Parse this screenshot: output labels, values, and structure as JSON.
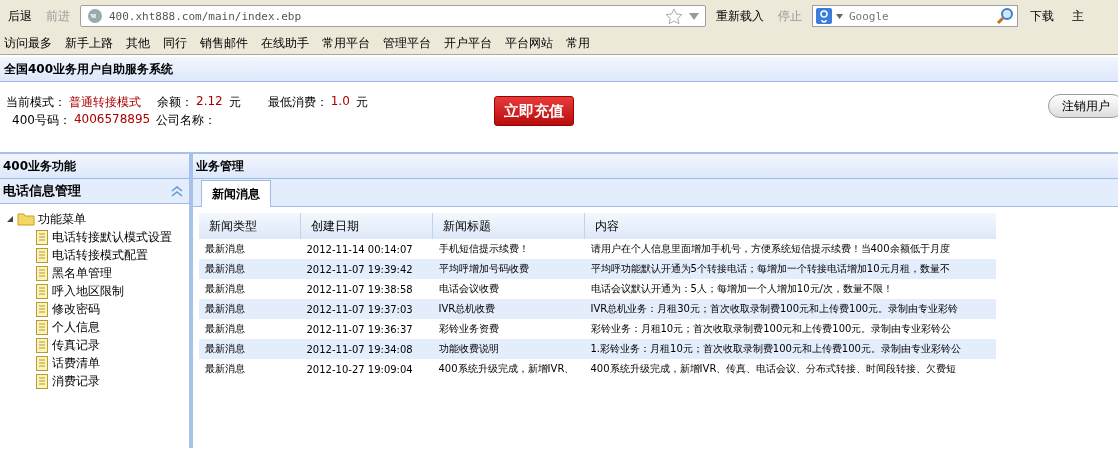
{
  "browser": {
    "nav": [
      {
        "label": "后退",
        "disabled": false
      },
      {
        "label": "前进",
        "disabled": true
      }
    ],
    "url": "400.xht888.com/main/index.ebp",
    "actions": [
      {
        "label": "重新载入",
        "disabled": false
      },
      {
        "label": "停止",
        "disabled": true
      }
    ],
    "search": {
      "placeholder": "Google"
    },
    "right": [
      "下载",
      "主"
    ],
    "bookmarks": [
      "访问最多",
      "新手上路",
      "其他",
      "同行",
      "销售邮件",
      "在线助手",
      "常用平台",
      "管理平台",
      "开户平台",
      "平台网站",
      "常用"
    ]
  },
  "header": {
    "title": "全国400业务用户自助服务系统"
  },
  "info": {
    "mode_label": "当前模式：",
    "mode": "普通转接模式",
    "balance_label": "余额：",
    "balance": "2.12",
    "unit1": "元",
    "min_label": "最低消费：",
    "min": "1.0",
    "unit2": "元",
    "number_label": "400号码：",
    "number": "4006578895",
    "company_label": "公司名称：",
    "recharge": "立即充值",
    "logout": "注销用户"
  },
  "sidebar": {
    "title": "400业务功能",
    "section": {
      "label": "电话信息管理",
      "expanded": true
    },
    "tree": [
      {
        "label": "功能菜单",
        "expanded": true,
        "children": [
          {
            "label": "电话转接默认模式设置"
          },
          {
            "label": "电话转接模式配置"
          },
          {
            "label": "黑名单管理"
          },
          {
            "label": "呼入地区限制"
          },
          {
            "label": "修改密码"
          },
          {
            "label": "个人信息"
          },
          {
            "label": "传真记录"
          },
          {
            "label": "话费清单"
          },
          {
            "label": "消费记录"
          }
        ]
      }
    ]
  },
  "main": {
    "title": "业务管理",
    "tabs": [
      {
        "label": "新闻消息",
        "selected": true
      }
    ],
    "table": {
      "columns": [
        "新闻类型",
        "创建日期",
        "新闻标题",
        "内容"
      ],
      "rows": [
        [
          "最新消息",
          "2012-11-14 00:14:07",
          "手机短信提示续费！",
          "请用户在个人信息里面增加手机号，方便系统短信提示续费！当400余额低于月度"
        ],
        [
          "最新消息",
          "2012-11-07 19:39:42",
          "平均呼增加号码收费",
          "平均呼功能默认开通为5个转接电话；每增加一个转接电话增加10元月租，数量不"
        ],
        [
          "最新消息",
          "2012-11-07 19:38:58",
          "电话会议收费",
          "电话会议默认开通为：5人；每增加一个人增加10元/次，数量不限！"
        ],
        [
          "最新消息",
          "2012-11-07 19:37:03",
          "IVR总机收费",
          "IVR总机业务：月租30元；首次收取录制费100元和上传费100元。录制由专业彩铃"
        ],
        [
          "最新消息",
          "2012-11-07 19:36:37",
          "彩铃业务资费",
          "彩铃业务：月租10元；首次收取录制费100元和上传费100元。录制由专业彩铃公"
        ],
        [
          "最新消息",
          "2012-11-07 19:34:08",
          "功能收费说明",
          "1.彩铃业务：月租10元；首次收取录制费100元和上传费100元。录制由专业彩铃公"
        ],
        [
          "最新消息",
          "2012-10-27 19:09:04",
          "400系统升级完成，新增IVR、",
          "400系统升级完成，新增IVR、传真、电话会议、分布式转接、时间段转接、欠费短"
        ]
      ]
    }
  }
}
